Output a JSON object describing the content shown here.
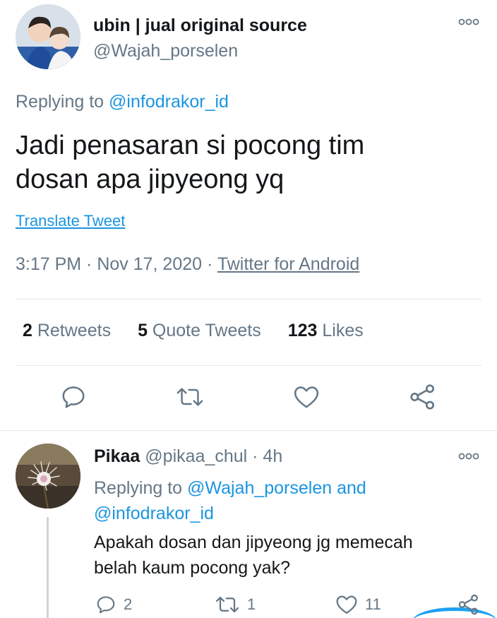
{
  "main_tweet": {
    "author_name": "ubin | jual original source",
    "author_handle": "@Wajah_porselen",
    "replying_prefix": "Replying to ",
    "replying_to": "@infodrakor_id",
    "text_line1": "Jadi penasaran si pocong tim",
    "text_line2": "dosan apa jipyeong yq",
    "translate_label": "Translate Tweet",
    "time": "3:17 PM",
    "separator": " · ",
    "date": "Nov 17, 2020",
    "source": "Twitter for Android",
    "stats": {
      "retweets_count": "2",
      "retweets_label": " Retweets",
      "quotes_count": "5",
      "quotes_label": " Quote Tweets",
      "likes_count": "123",
      "likes_label": " Likes"
    },
    "actions": [
      "reply-icon",
      "retweet-icon",
      "like-icon",
      "share-icon"
    ]
  },
  "reply_tweet": {
    "author_name": "Pikaa",
    "author_handle": " @pikaa_chul",
    "separator": " · ",
    "time": "4h",
    "replying_prefix": "Replying to ",
    "replying_to_1": "@Wajah_porselen",
    "replying_and": " and",
    "replying_to_2": "@infodrakor_id",
    "text_line1": "Apakah dosan dan jipyeong jg memecah",
    "text_line2": "belah kaum pocong yak?",
    "reply_count": "2",
    "retweet_count": "1",
    "like_count": "11"
  },
  "colors": {
    "text": "#14171a",
    "secondary": "#657786",
    "link": "#1b95e0",
    "divider": "#e1e8ed",
    "accent": "#1da1f2"
  }
}
